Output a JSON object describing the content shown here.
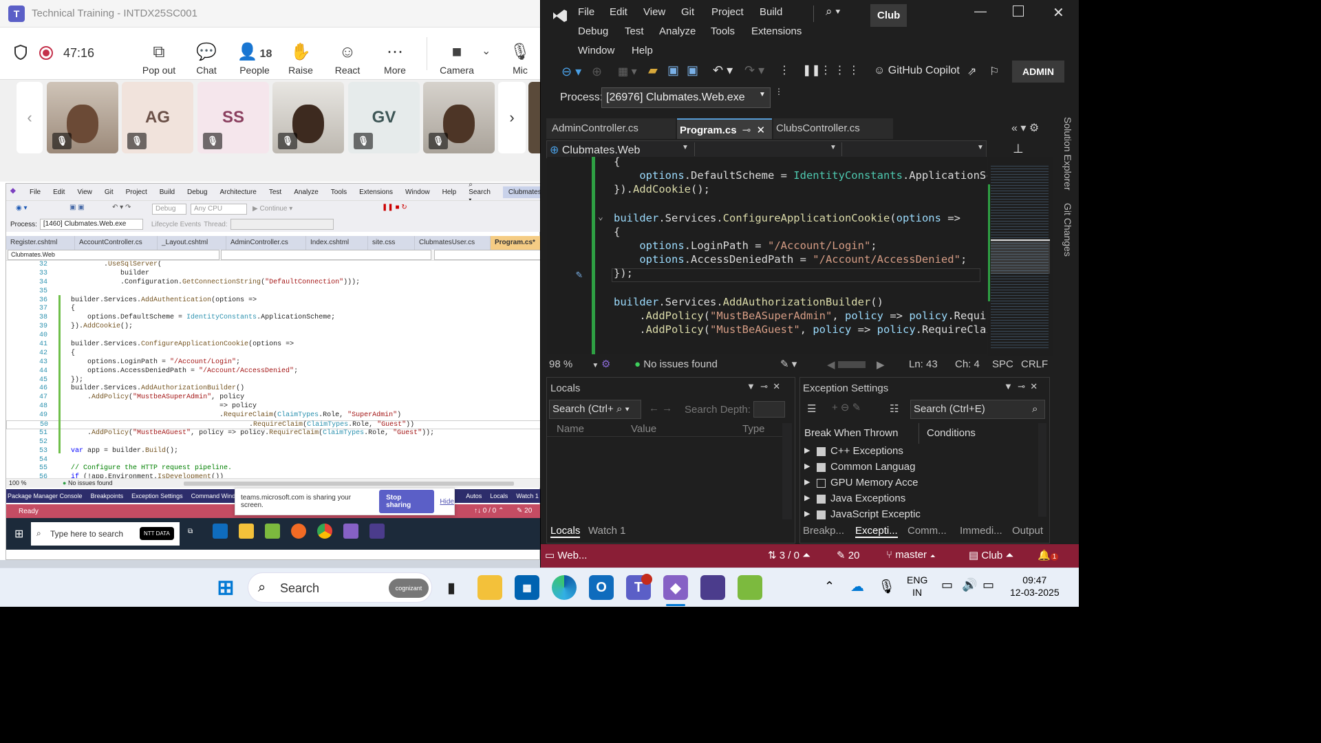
{
  "teams": {
    "title": "Technical Training - INTDX25SC001",
    "timer": "47:16",
    "buttons": [
      {
        "label": "Pop out",
        "icon": "popout-icon"
      },
      {
        "label": "Chat",
        "icon": "chat-icon"
      },
      {
        "label": "People",
        "icon": "people-icon",
        "badge": "18"
      },
      {
        "label": "Raise",
        "icon": "raise-hand-icon"
      },
      {
        "label": "React",
        "icon": "react-icon"
      },
      {
        "label": "More",
        "icon": "more-icon"
      },
      {
        "label": "Camera",
        "icon": "camera-icon"
      },
      {
        "label": "Mic",
        "icon": "mic-off-icon"
      }
    ],
    "participants": [
      {
        "type": "video"
      },
      {
        "initials": "AG"
      },
      {
        "initials": "SS"
      },
      {
        "type": "video"
      },
      {
        "initials": "GV"
      },
      {
        "type": "video"
      }
    ]
  },
  "inner_vs": {
    "menu": [
      "File",
      "Edit",
      "View",
      "Git",
      "Project",
      "Build",
      "Debug",
      "Architecture",
      "Test",
      "Analyze",
      "Tools",
      "Extensions",
      "Window",
      "Help"
    ],
    "search": "Search",
    "solution": "Clubmates",
    "toolbar": {
      "config": "Debug",
      "platform": "Any CPU",
      "continue": "Continue"
    },
    "process_label": "Process:",
    "process": "[1460] Clubmates.Web.exe",
    "lifecycle": "Lifecycle Events",
    "thread": "Thread:",
    "tabs": [
      "Register.cshtml",
      "AccountController.cs",
      "_Layout.cshtml",
      "AdminController.cs",
      "Index.cshtml",
      "site.css",
      "ClubmatesUser.cs",
      "Program.cs*"
    ],
    "project": "Clubmates.Web",
    "code": [
      {
        "n": "32",
        "t": "        .UseSqlServer("
      },
      {
        "n": "33",
        "t": "            builder"
      },
      {
        "n": "34",
        "t": "            .Configuration.GetConnectionString(\"DefaultConnection\")));"
      },
      {
        "n": "35",
        "t": ""
      },
      {
        "n": "36",
        "t": "builder.Services.AddAuthentication(options =>"
      },
      {
        "n": "37",
        "t": "{"
      },
      {
        "n": "38",
        "t": "    options.DefaultScheme = IdentityConstants.ApplicationScheme;"
      },
      {
        "n": "39",
        "t": "}).AddCookie();"
      },
      {
        "n": "40",
        "t": ""
      },
      {
        "n": "41",
        "t": "builder.Services.ConfigureApplicationCookie(options =>"
      },
      {
        "n": "42",
        "t": "{"
      },
      {
        "n": "43",
        "t": "    options.LoginPath = \"/Account/Login\";"
      },
      {
        "n": "44",
        "t": "    options.AccessDeniedPath = \"/Account/AccessDenied\";"
      },
      {
        "n": "45",
        "t": "});"
      },
      {
        "n": "46",
        "t": "builder.Services.AddAuthorizationBuilder()"
      },
      {
        "n": "47",
        "t": "    .AddPolicy(\"MustbeASuperAdmin\", policy"
      },
      {
        "n": "48",
        "t": "                                    => policy"
      },
      {
        "n": "49",
        "t": "                                    .RequireClaim(ClaimTypes.Role, \"SuperAdmin\")"
      },
      {
        "n": "50",
        "t": "                                           .RequireClaim(ClaimTypes.Role, \"Guest\"))"
      },
      {
        "n": "51",
        "t": "    .AddPolicy(\"MustbeAGuest\", policy => policy.RequireClaim(ClaimTypes.Role, \"Guest\"));"
      },
      {
        "n": "52",
        "t": ""
      },
      {
        "n": "53",
        "t": "var app = builder.Build();"
      },
      {
        "n": "54",
        "t": ""
      },
      {
        "n": "55",
        "t": "// Configure the HTTP request pipeline."
      },
      {
        "n": "56",
        "t": "if (!app.Environment.IsDevelopment())"
      }
    ],
    "zoom": "100 %",
    "issues": "No issues found",
    "bottom_tabs": [
      "Package Manager Console",
      "Breakpoints",
      "Exception Settings",
      "Command Windo",
      "Autos",
      "Locals",
      "Watch 1"
    ],
    "status": "Ready",
    "status_right": "↑↓ 0 / 0 ⌃",
    "status_edits": "✎ 20",
    "share_text": "teams.microsoft.com is sharing your screen.",
    "stop_sharing": "Stop sharing",
    "hide": "Hide",
    "taskbar_search": "Type here to search",
    "ntt": "NTT DATA"
  },
  "vs": {
    "menu_row1": [
      "File",
      "Edit",
      "View",
      "Git",
      "Project",
      "Build"
    ],
    "menu_row2": [
      "Debug",
      "Test",
      "Analyze",
      "Tools",
      "Extensions"
    ],
    "menu_row3": [
      "Window",
      "Help"
    ],
    "solution": "Club",
    "copilot": "GitHub Copilot",
    "admin": "ADMIN",
    "process_label": "Process:",
    "process": "[26976] Clubmates.Web.exe",
    "tabs": [
      {
        "label": "AdminController.cs"
      },
      {
        "label": "Program.cs",
        "active": true
      },
      {
        "label": "ClubsController.cs"
      }
    ],
    "project": "Clubmates.Web",
    "side_tabs": [
      "Solution Explorer",
      "Git Changes"
    ],
    "code": [
      "{",
      "    options.DefaultScheme = IdentityConstants.ApplicationSc",
      "}).AddCookie();",
      "",
      "builder.Services.ConfigureApplicationCookie(options =>",
      "{",
      "    options.LoginPath = \"/Account/Login\";",
      "    options.AccessDeniedPath = \"/Account/AccessDenied\";",
      "});",
      "",
      "builder.Services.AddAuthorizationBuilder()",
      "    .AddPolicy(\"MustBeASuperAdmin\", policy => policy.Requir",
      "    .AddPolicy(\"MustBeAGuest\", policy => policy.RequireClai"
    ],
    "zoom": "98 %",
    "issues": "No issues found",
    "ln": "Ln: 43",
    "ch": "Ch: 4",
    "spc": "SPC",
    "crlf": "CRLF",
    "locals": {
      "title": "Locals",
      "search": "Search (Ctrl+",
      "depth": "Search Depth:",
      "cols": [
        "Name",
        "Value",
        "Type"
      ],
      "tabs": [
        "Locals",
        "Watch 1"
      ]
    },
    "exceptions": {
      "title": "Exception Settings",
      "search": "Search (Ctrl+E)",
      "cols": [
        "Break When Thrown",
        "Conditions"
      ],
      "items": [
        "C++ Exceptions",
        "Common Languag",
        "GPU Memory Acce",
        "Java Exceptions",
        "JavaScript Exceptic"
      ],
      "tabs": [
        "Breakp...",
        "Excepti...",
        "Comm...",
        "Immedi...",
        "Output"
      ]
    },
    "status": {
      "left": "Web...",
      "sync": "3 / 0",
      "edits": "20",
      "branch": "master",
      "repo": "Club",
      "notif": "1"
    }
  },
  "taskbar": {
    "search": "Search",
    "lang1": "ENG",
    "lang2": "IN",
    "time": "09:47",
    "date": "12-03-2025",
    "cognizant": "cognizant"
  }
}
